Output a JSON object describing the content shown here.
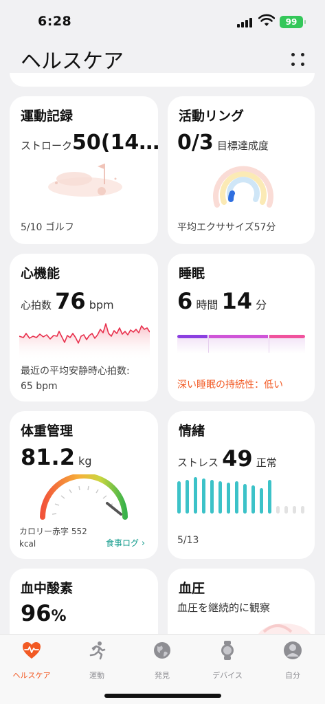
{
  "status": {
    "time": "6:28",
    "battery": "99"
  },
  "header": {
    "title": "ヘルスケア"
  },
  "cards": {
    "exercise": {
      "title": "運動記録",
      "label": "ストローク",
      "value": "50(14…",
      "footer": "5/10 ゴルフ"
    },
    "activity": {
      "title": "活動リング",
      "value": "0/3",
      "label": "目標達成度",
      "footer": "平均エクササイズ57分"
    },
    "heart": {
      "title": "心機能",
      "label": "心拍数",
      "value": "76",
      "unit": "bpm",
      "footer_line1": "最近の平均安静時心拍数:",
      "footer_line2": "65 bpm"
    },
    "sleep": {
      "title": "睡眠",
      "hours": "6",
      "hours_unit": "時間",
      "minutes": "14",
      "minutes_unit": "分",
      "footer": "深い睡眠の持続性：低い"
    },
    "weight": {
      "title": "体重管理",
      "value": "81.2",
      "unit": "kg",
      "footer_line1": "カロリー赤字 552",
      "footer_line2": "kcal",
      "link": "食事ログ"
    },
    "emotion": {
      "title": "情緒",
      "label": "ストレス",
      "value": "49",
      "status": "正常",
      "footer": "5/13"
    },
    "spo2": {
      "title": "血中酸素",
      "value": "96",
      "unit": "%"
    },
    "bp": {
      "title": "血圧",
      "subtitle": "血圧を継続的に観察"
    }
  },
  "tabs": [
    {
      "label": "ヘルスケア",
      "icon": "heart-pulse-icon",
      "active": true
    },
    {
      "label": "運動",
      "icon": "runner-icon",
      "active": false
    },
    {
      "label": "発見",
      "icon": "globe-icon",
      "active": false
    },
    {
      "label": "デバイス",
      "icon": "watch-icon",
      "active": false
    },
    {
      "label": "自分",
      "icon": "profile-icon",
      "active": false
    }
  ],
  "colors": {
    "accent": "#f25a24",
    "teal": "#3cc2c8",
    "heart": "#e8304d",
    "link": "#0f9a8a"
  }
}
